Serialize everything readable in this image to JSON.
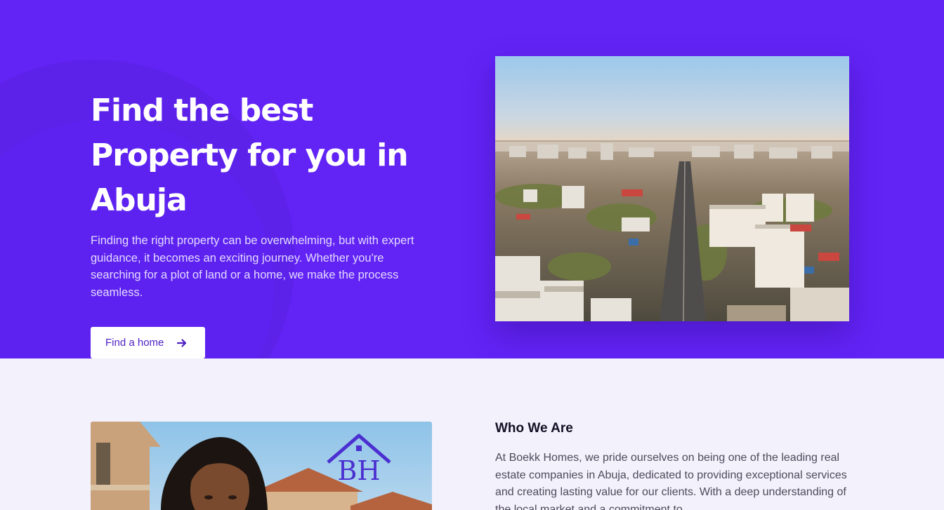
{
  "hero": {
    "title": "Find the best Property for you in Abuja",
    "description": "Finding the right property can be overwhelming, but with expert guidance, it becomes an exciting journey. Whether you're searching for a plot of land or a home, we make the process seamless.",
    "cta_label": "Find a home",
    "cta_icon": "arrow-right-icon",
    "background_color": "#6223f5"
  },
  "hero_image": {
    "alt": "Aerial view of Abuja city skyline"
  },
  "about": {
    "heading": "Who We Are",
    "text": "At Boekk Homes, we pride ourselves on being one of the leading real estate companies in Abuja, dedicated to providing exceptional services and creating lasting value for our clients. With a deep understanding of the local market and a commitment to",
    "logo_text": "BH"
  }
}
